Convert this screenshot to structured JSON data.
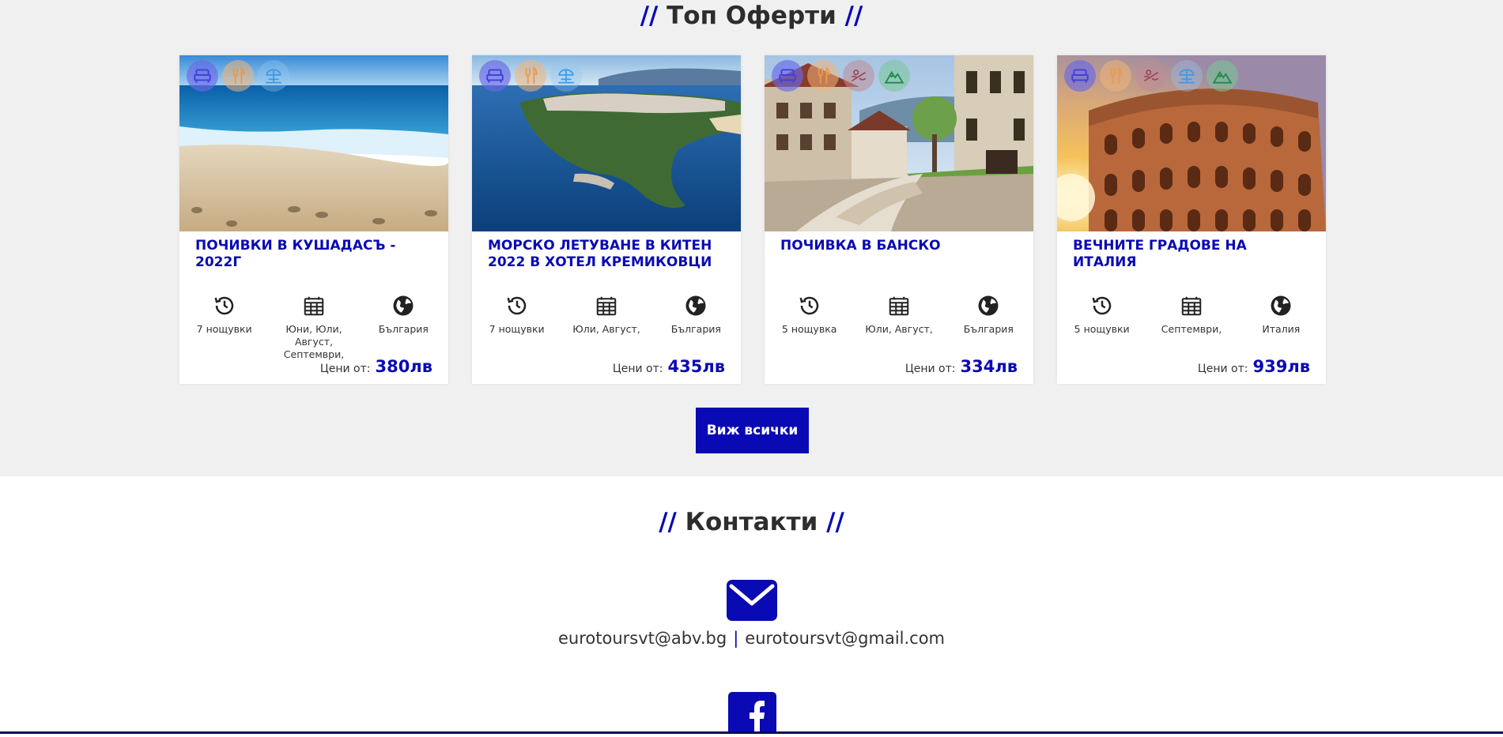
{
  "offers": {
    "title": "Топ Оферти",
    "slashes_left": "//",
    "slashes_right": "//",
    "price_label": "Цени от:",
    "cards": [
      {
        "title": "ПОЧИВКИ В КУШАДАСЪ - 2022Г",
        "nights": "7 нощувки",
        "months": "Юни, Юли, Август, Септември,",
        "country": "България",
        "price": "380лв"
      },
      {
        "title": "МОРСКО ЛЕТУВАНЕ В КИТЕН 2022 В ХОТЕЛ КРЕМИКОВЦИ",
        "nights": "7 нощувки",
        "months": "Юли, Август,",
        "country": "България",
        "price": "435лв"
      },
      {
        "title": "ПОЧИВКА В БАНСКО",
        "nights": "5 нощувка",
        "months": "Юли, Август,",
        "country": "България",
        "price": "334лв"
      },
      {
        "title": "ВЕЧНИТЕ ГРАДОВЕ НА ИТАЛИЯ",
        "nights": "5 нощувки",
        "months": "Септември,",
        "country": "Италия",
        "price": "939лв"
      }
    ],
    "view_all_label": "Виж всички"
  },
  "contacts": {
    "title": "Контакти",
    "slashes_left": "//",
    "slashes_right": "//",
    "email_primary": "eurotoursvt@abv.bg",
    "email_separator": "|",
    "email_secondary": "eurotoursvt@gmail.com"
  },
  "colors": {
    "accent": "#0a0ab4",
    "section_bg": "#f0f0f0",
    "text": "#333333"
  },
  "icons": {
    "amenities": [
      "bed-icon",
      "fork-knife-icon",
      "beach-umbrella-icon",
      "spa-icon",
      "mountain-icon"
    ],
    "stats": [
      "history-icon",
      "calendar-icon",
      "globe-icon"
    ],
    "contact": [
      "envelope-icon",
      "facebook-icon"
    ]
  }
}
